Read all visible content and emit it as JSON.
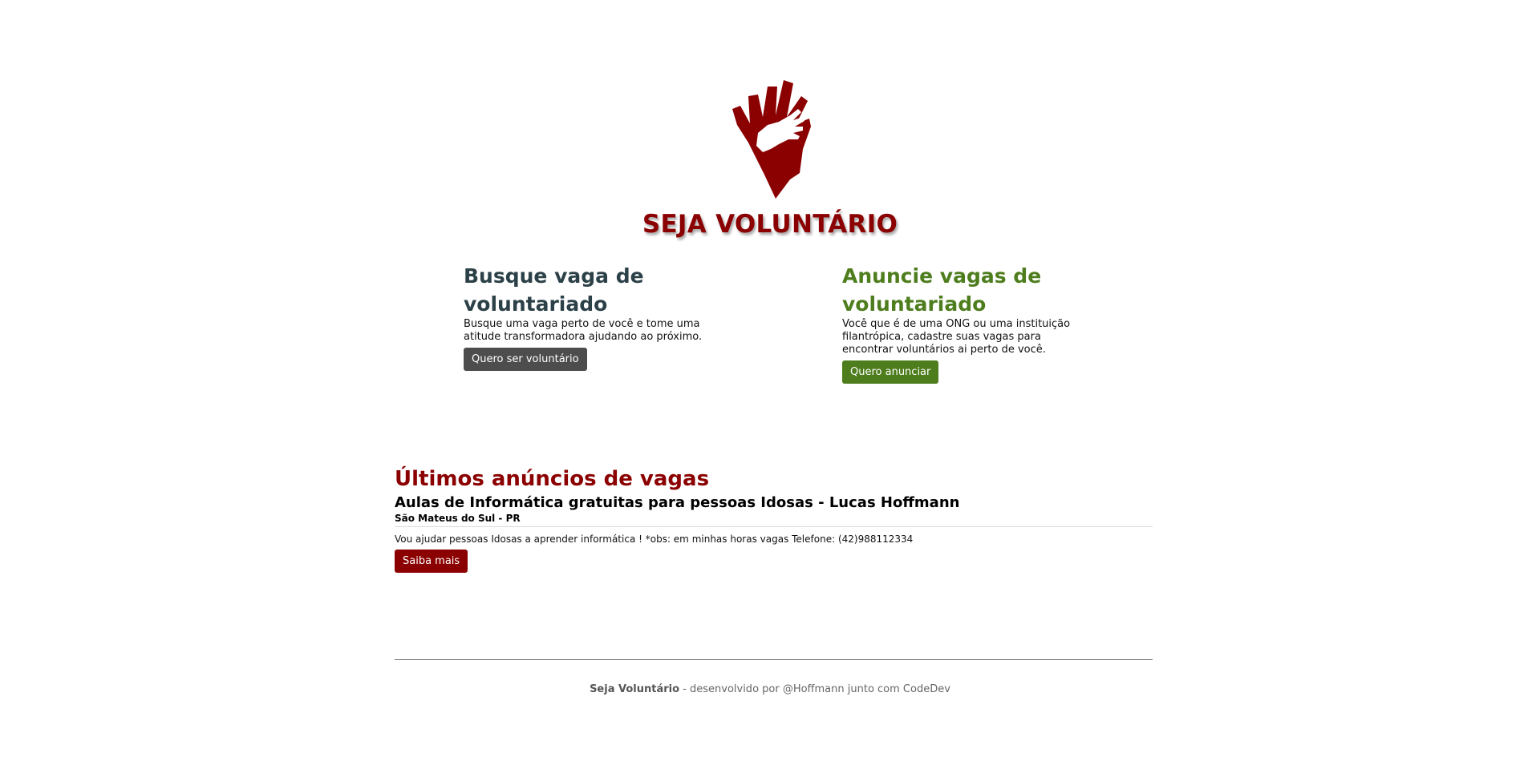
{
  "brand": {
    "logo_icon": "hands-logo-icon",
    "title": "SEJA VOLUNTÁRIO",
    "color": "#8b0000"
  },
  "cta_left": {
    "heading": "Busque vaga de voluntariado",
    "text": "Busque uma vaga perto de você e tome uma atitude transformadora ajudando ao próximo.",
    "button": "Quero ser voluntário",
    "color": "#2b4047"
  },
  "cta_right": {
    "heading": "Anuncie vagas de voluntariado",
    "text": "Você que é de uma ONG ou uma instituição filantrópica, cadastre suas vagas para encontrar voluntários ai perto de você.",
    "button": "Quero anunciar",
    "color": "#4e7d1d"
  },
  "listings": {
    "heading": "Últimos anúncios de vagas",
    "items": [
      {
        "title": "Aulas de Informática gratuitas para pessoas Idosas - Lucas Hoffmann",
        "location": "São Mateus do Sul - PR",
        "description": "Vou ajudar pessoas Idosas a aprender informática ! *obs: em minhas horas vagas Telefone: (42)988112334",
        "button": "Saiba mais"
      }
    ]
  },
  "footer": {
    "brand": "Seja Voluntário",
    "text": " - desenvolvido por @Hoffmann junto com CodeDev"
  }
}
